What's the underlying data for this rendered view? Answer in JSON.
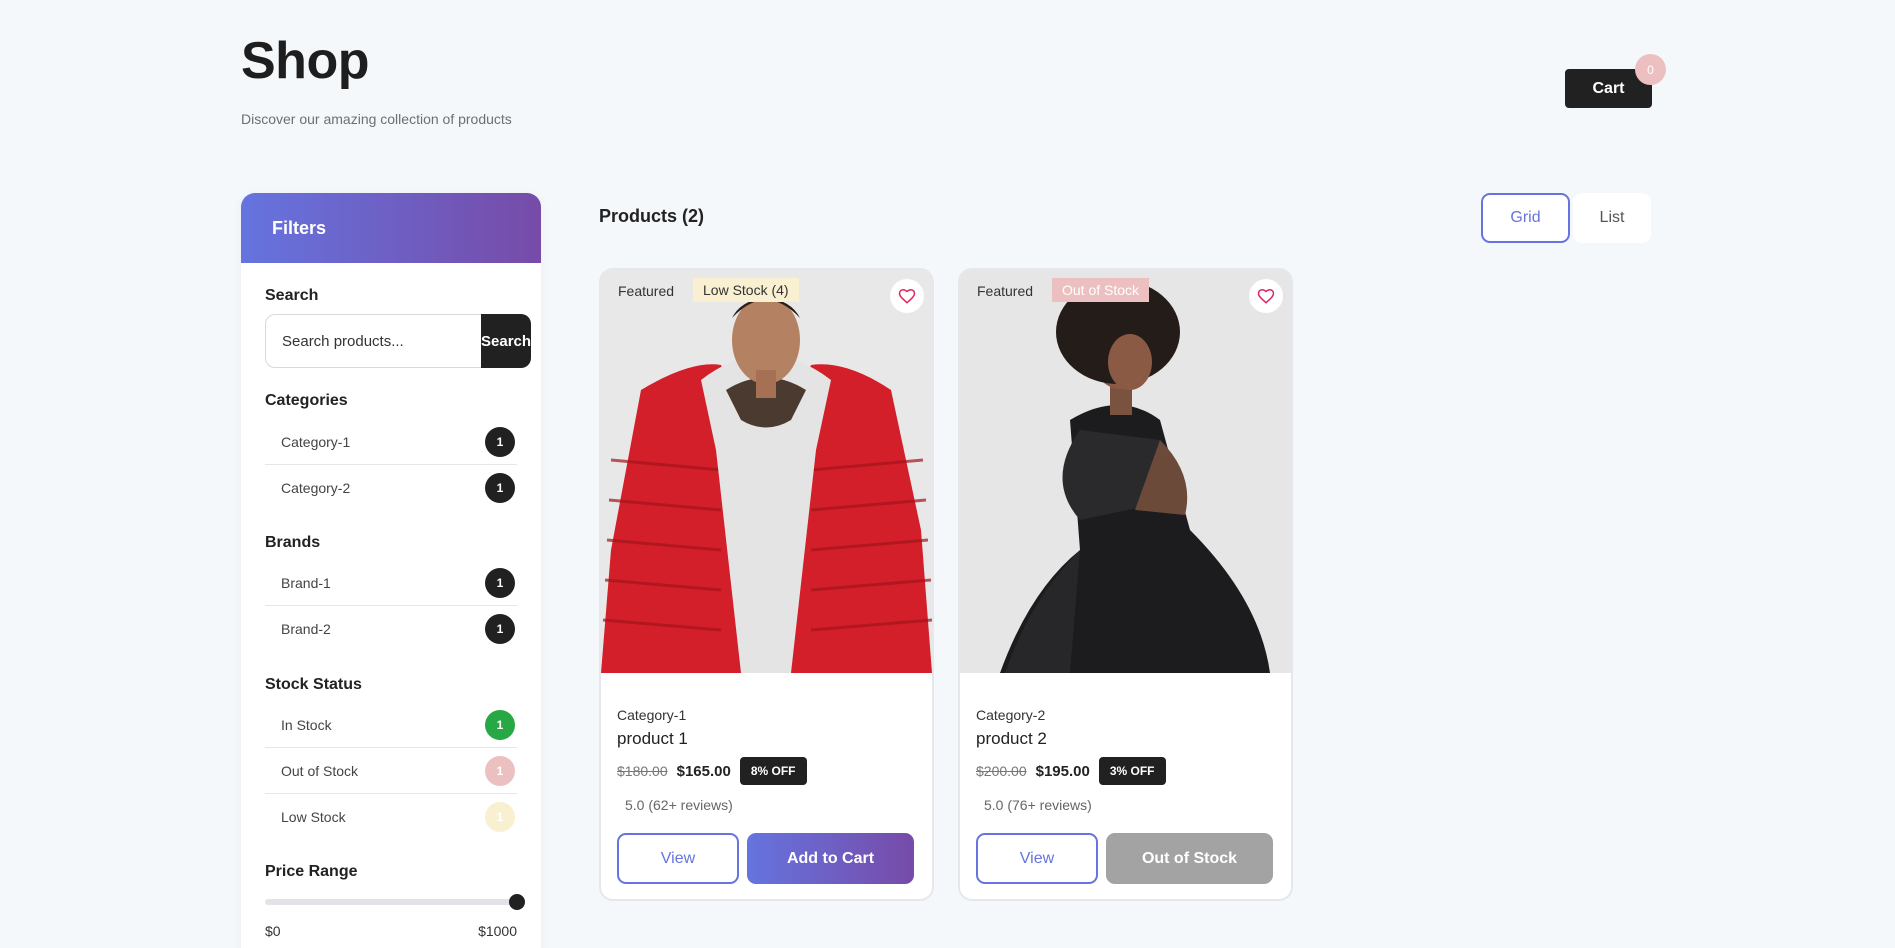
{
  "header": {
    "title": "Shop",
    "subtitle": "Discover our amazing collection of products"
  },
  "cart": {
    "label": "Cart",
    "count": "0"
  },
  "sidebar": {
    "title": "Filters",
    "search": {
      "label": "Search",
      "placeholder": "Search products...",
      "button": "Search"
    },
    "categories": {
      "label": "Categories",
      "items": [
        {
          "label": "Category-1",
          "count": "1"
        },
        {
          "label": "Category-2",
          "count": "1"
        }
      ]
    },
    "brands": {
      "label": "Brands",
      "items": [
        {
          "label": "Brand-1",
          "count": "1"
        },
        {
          "label": "Brand-2",
          "count": "1"
        }
      ]
    },
    "stock": {
      "label": "Stock Status",
      "items": [
        {
          "label": "In Stock",
          "count": "1",
          "color": "#28a745"
        },
        {
          "label": "Out of Stock",
          "count": "1",
          "color": "#ecc0c0"
        },
        {
          "label": "Low Stock",
          "count": "1",
          "color": "#f8f0d0"
        }
      ]
    },
    "price": {
      "label": "Price Range",
      "min": "$0",
      "max": "$1000",
      "value": 1.0
    }
  },
  "main": {
    "products_title": "Products (2)",
    "view": {
      "grid": "Grid",
      "list": "List",
      "active": "grid"
    },
    "products": [
      {
        "featured": "Featured",
        "stock_badge": "Low Stock (4)",
        "stock_badge_bg": "#f8f0d0",
        "stock_badge_color": "#333333",
        "image": "red-puffer-jacket-photo",
        "category": "Category-1",
        "name": "product 1",
        "old_price": "$180.00",
        "price": "$165.00",
        "discount": "8% OFF",
        "rating": "5.0 (62+ reviews)",
        "view_label": "View",
        "action_label": "Add to Cart",
        "action_enabled": true
      },
      {
        "featured": "Featured",
        "stock_badge": "Out of Stock",
        "stock_badge_bg": "#ecc0c0",
        "stock_badge_color": "#ffffff",
        "image": "black-dress-photo",
        "category": "Category-2",
        "name": "product 2",
        "old_price": "$200.00",
        "price": "$195.00",
        "discount": "3% OFF",
        "rating": "5.0 (76+ reviews)",
        "view_label": "View",
        "action_label": "Out of Stock",
        "action_enabled": false
      }
    ]
  },
  "colors": {
    "accent": "#6574df",
    "gradient_end": "#774ba8",
    "dark": "#212121",
    "heart": "#e0245e",
    "disabled": "#a3a3a3"
  }
}
